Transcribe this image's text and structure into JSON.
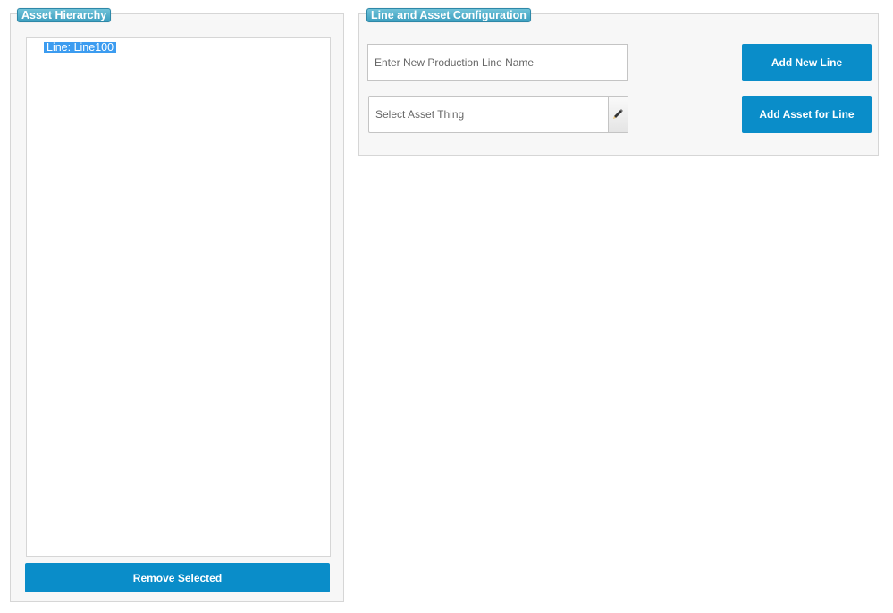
{
  "asset_hierarchy": {
    "title": "Asset Hierarchy",
    "items": [
      {
        "label": "Line: Line100",
        "selected": true
      }
    ],
    "remove_button_label": "Remove Selected"
  },
  "configuration": {
    "title": "Line and Asset Configuration",
    "line_name_input": {
      "placeholder": "Enter New Production Line Name",
      "value": ""
    },
    "add_line_button_label": "Add New Line",
    "asset_picker": {
      "placeholder": "Select Asset Thing",
      "icon": "pencil-icon"
    },
    "add_asset_button_label": "Add Asset for Line"
  },
  "colors": {
    "accent": "#0a8dc9",
    "title_badge": "#4aaecb",
    "selection": "#3c9cf0",
    "panel_bg": "#f7f7f7"
  }
}
